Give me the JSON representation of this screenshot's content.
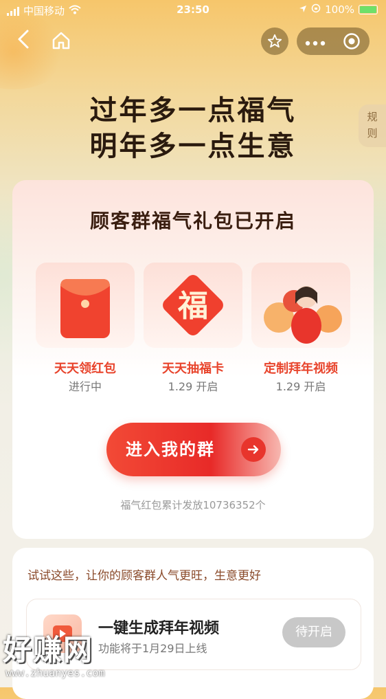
{
  "status_bar": {
    "carrier": "中国移动",
    "time": "23:50",
    "battery": "100%"
  },
  "nav": {
    "back_icon": "chevron-left-icon",
    "home_icon": "home-icon",
    "star_icon": "star-icon",
    "more_icon": "more-dots-icon",
    "close_icon": "target-circle-icon"
  },
  "headline": {
    "line1": "过年多一点福气",
    "line2": "明年多一点生意"
  },
  "rules_tab": {
    "label1": "规",
    "label2": "则"
  },
  "main_card": {
    "title": "顾客群福气礼包已开启",
    "tiles": [
      {
        "label": "天天领红包",
        "status": "进行中",
        "icon": "red-envelope-icon"
      },
      {
        "label": "天天抽福卡",
        "status": "1.29 开启",
        "icon": "fu-card-icon"
      },
      {
        "label": "定制拜年视频",
        "status": "1.29 开启",
        "icon": "video-thumbnail"
      }
    ],
    "fu_char": "福",
    "cta_label": "进入我的群",
    "counter_text": "福气红包累计发放10736352个"
  },
  "secondary_card": {
    "title": "试试这些，让你的顾客群人气更旺，生意更好",
    "item": {
      "title": "一键生成拜年视频",
      "subtitle": "功能将于1月29日上线",
      "button": "待开启"
    }
  },
  "watermark": {
    "main": "好赚网",
    "url": "www.zhuanyes.com"
  },
  "colors": {
    "accent_red": "#e8352c",
    "title_brown": "#3a1e10",
    "highlight_orange": "#e8442c"
  }
}
